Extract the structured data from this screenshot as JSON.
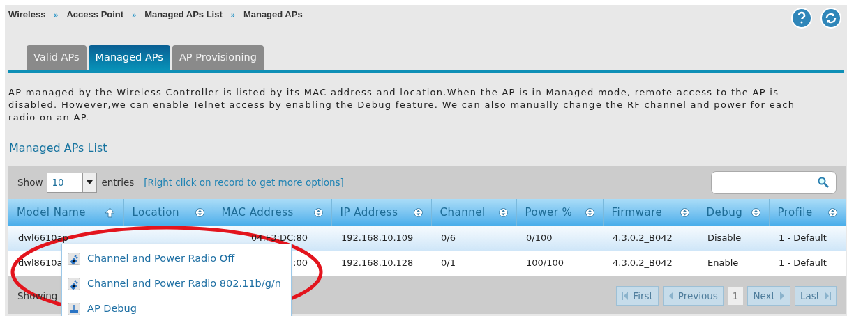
{
  "breadcrumb": [
    "Wireless",
    "Access Point",
    "Managed APs List",
    "Managed APs"
  ],
  "breadcrumb_separator": "»",
  "tabs": [
    {
      "label": "Valid APs",
      "selected": false
    },
    {
      "label": "Managed APs",
      "selected": true
    },
    {
      "label": "AP Provisioning",
      "selected": false
    }
  ],
  "description": "AP managed by the Wireless Controller is listed by its MAC address and location.When the AP is in Managed mode, remote access to the AP is disabled. However,we can enable Telnet access by enabling the Debug feature. We can also manually change the RF channel and power for each radio on an AP.",
  "section_title": "Managed APs List",
  "toolbar": {
    "show_label": "Show",
    "page_size": "10",
    "entries_label": "entries",
    "hint": "[Right click on record to get more options]"
  },
  "table": {
    "columns": [
      {
        "label": "Model Name",
        "sorted": true
      },
      {
        "label": "Location",
        "sorted": false
      },
      {
        "label": "MAC Address",
        "sorted": false
      },
      {
        "label": "IP Address",
        "sorted": false
      },
      {
        "label": "Channel",
        "sorted": false
      },
      {
        "label": "Power %",
        "sorted": false
      },
      {
        "label": "Firmware",
        "sorted": false
      },
      {
        "label": "Debug",
        "sorted": false
      },
      {
        "label": "Profile",
        "sorted": false
      }
    ],
    "rows": [
      {
        "selected": true,
        "cells": [
          "dwl6610ap",
          "",
          "04:F3:DC:80",
          "192.168.10.109",
          "0/6",
          "0/100",
          "4.3.0.2_B042",
          "Disable",
          "1 - Default"
        ]
      },
      {
        "selected": false,
        "cells": [
          "dwl8610a",
          "",
          ":00",
          "192.168.10.128",
          "0/1",
          "100/100",
          "4.3.0.2_B042",
          "Enable",
          "1 - Default"
        ]
      }
    ]
  },
  "footer": {
    "info": "Showing",
    "pagination": [
      {
        "label": "First",
        "kind": "first"
      },
      {
        "label": "Previous",
        "kind": "prev"
      },
      {
        "label": "1",
        "kind": "page"
      },
      {
        "label": "Next",
        "kind": "next"
      },
      {
        "label": "Last",
        "kind": "last"
      }
    ]
  },
  "context_menu": [
    {
      "label": "Channel and Power Radio Off",
      "kind": "radio"
    },
    {
      "label": "Channel and Power Radio 802.11b/g/n",
      "kind": "radio"
    },
    {
      "label": "AP Debug",
      "kind": "debug"
    }
  ]
}
